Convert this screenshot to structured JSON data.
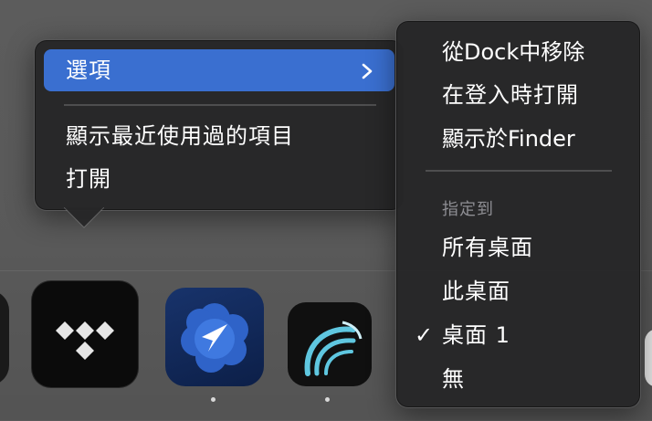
{
  "context_menu": {
    "items": [
      {
        "label": "選項",
        "has_submenu": true,
        "highlighted": true
      },
      {
        "label": "顯示最近使用過的項目"
      },
      {
        "label": "打開"
      }
    ],
    "highlight_color": "#3a6fd0"
  },
  "submenu": {
    "items": [
      "從Dock中移除",
      "在登入時打開",
      "顯示於Finder"
    ],
    "section_label": "指定到",
    "assign_options": [
      {
        "label": "所有桌面",
        "checked": false
      },
      {
        "label": "此桌面",
        "checked": false
      },
      {
        "label": "桌面 1",
        "checked": true
      },
      {
        "label": "無",
        "checked": false
      }
    ],
    "check_glyph": "✓"
  },
  "dock": {
    "apps": [
      {
        "icon": "tidal-icon",
        "running": false
      },
      {
        "icon": "navigation-arrow-icon",
        "running": true
      },
      {
        "icon": "wave-app-icon",
        "running": true
      }
    ]
  }
}
